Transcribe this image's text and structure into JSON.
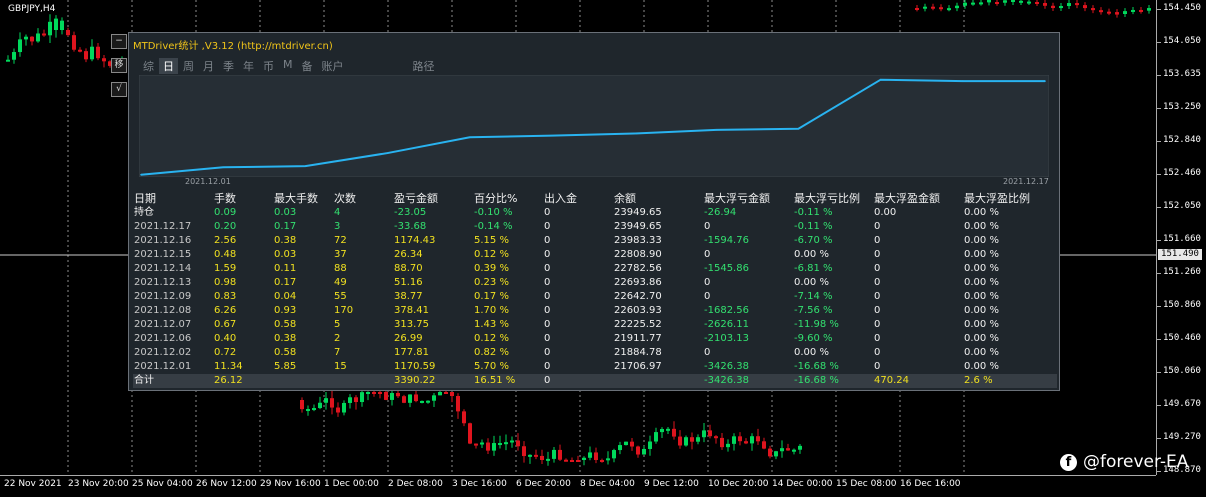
{
  "symbol": "GBPJPY,H4",
  "colors": {
    "bull": "#00d95c",
    "bear": "#e0141e",
    "line": "#29b3f0",
    "yellow": "#f0e020",
    "green": "#33e070",
    "gray": "#c8c8c8",
    "grid": "#ffffff"
  },
  "price_axis": {
    "labels": [
      "154.450",
      "154.050",
      "153.635",
      "153.250",
      "152.840",
      "152.460",
      "152.050",
      "151.660",
      "151.260",
      "150.860",
      "150.460",
      "150.060",
      "149.670",
      "149.270",
      "148.870"
    ],
    "current": "151.490"
  },
  "time_axis": {
    "labels": [
      "22 Nov 2021",
      "23 Nov 20:00",
      "25 Nov 04:00",
      "26 Nov 12:00",
      "29 Nov 16:00",
      "1 Dec 00:00",
      "2 Dec 08:00",
      "3 Dec 16:00",
      "6 Dec 20:00",
      "8 Dec 04:00",
      "9 Dec 12:00",
      "10 Dec 20:00",
      "14 Dec 00:00",
      "15 Dec 08:00",
      "16 Dec 16:00"
    ]
  },
  "side_buttons": [
    "−",
    "移",
    "√"
  ],
  "panel": {
    "title": "MTDriver统计 ,V3.12 (http://mtdriver.cn)",
    "tabs": [
      "综",
      "日",
      "周",
      "月",
      "季",
      "年",
      "币",
      "M",
      "备",
      "账户",
      "路径"
    ],
    "active_tab": 1,
    "start_date": "2021.12.01",
    "end_date": "2021.12.17"
  },
  "chart_data": {
    "type": "line",
    "x": [
      "2021.12.01",
      "2021.12.02",
      "2021.12.06",
      "2021.12.07",
      "2021.12.08",
      "2021.12.09",
      "2021.12.13",
      "2021.12.14",
      "2021.12.15",
      "2021.12.16",
      "2021.12.17",
      "持仓"
    ],
    "values": [
      21706.97,
      21884.78,
      21911.77,
      22225.52,
      22603.93,
      22642.7,
      22693.86,
      22782.56,
      22808.9,
      23983.33,
      23949.65,
      23949.65
    ],
    "ylim": [
      21700,
      24000
    ]
  },
  "table": {
    "headers": [
      "日期",
      "手数",
      "最大手数",
      "次数",
      "盈亏金额",
      "百分比%",
      "出入金",
      "余额",
      "最大浮亏金额",
      "最大浮亏比例",
      "最大浮盈金额",
      "最大浮盈比例"
    ],
    "rows": [
      [
        "持仓",
        "0.09",
        "0.03",
        "4",
        "-23.05",
        "-0.10 %",
        "0",
        "23949.65",
        "-26.94",
        "-0.11 %",
        "0.00",
        "0.00 %"
      ],
      [
        "2021.12.17",
        "0.20",
        "0.17",
        "3",
        "-33.68",
        "-0.14 %",
        "0",
        "23949.65",
        "0",
        "-0.11 %",
        "0",
        "0.00 %"
      ],
      [
        "2021.12.16",
        "2.56",
        "0.38",
        "72",
        "1174.43",
        "5.15 %",
        "0",
        "23983.33",
        "-1594.76",
        "-6.70 %",
        "0",
        "0.00 %"
      ],
      [
        "2021.12.15",
        "0.48",
        "0.03",
        "37",
        "26.34",
        "0.12 %",
        "0",
        "22808.90",
        "0",
        "0.00 %",
        "0",
        "0.00 %"
      ],
      [
        "2021.12.14",
        "1.59",
        "0.11",
        "88",
        "88.70",
        "0.39 %",
        "0",
        "22782.56",
        "-1545.86",
        "-6.81 %",
        "0",
        "0.00 %"
      ],
      [
        "2021.12.13",
        "0.98",
        "0.17",
        "49",
        "51.16",
        "0.23 %",
        "0",
        "22693.86",
        "0",
        "0.00 %",
        "0",
        "0.00 %"
      ],
      [
        "2021.12.09",
        "0.83",
        "0.04",
        "55",
        "38.77",
        "0.17 %",
        "0",
        "22642.70",
        "0",
        "-7.14 %",
        "0",
        "0.00 %"
      ],
      [
        "2021.12.08",
        "6.26",
        "0.93",
        "170",
        "378.41",
        "1.70 %",
        "0",
        "22603.93",
        "-1682.56",
        "-7.56 %",
        "0",
        "0.00 %"
      ],
      [
        "2021.12.07",
        "0.67",
        "0.58",
        "5",
        "313.75",
        "1.43 %",
        "0",
        "22225.52",
        "-2626.11",
        "-11.98 %",
        "0",
        "0.00 %"
      ],
      [
        "2021.12.06",
        "0.40",
        "0.38",
        "2",
        "26.99",
        "0.12 %",
        "0",
        "21911.77",
        "-2103.13",
        "-9.60 %",
        "0",
        "0.00 %"
      ],
      [
        "2021.12.02",
        "0.72",
        "0.58",
        "7",
        "177.81",
        "0.82 %",
        "0",
        "21884.78",
        "0",
        "0.00 %",
        "0",
        "0.00 %"
      ],
      [
        "2021.12.01",
        "11.34",
        "5.85",
        "15",
        "1170.59",
        "5.70 %",
        "0",
        "21706.97",
        "-3426.38",
        "-16.68 %",
        "0",
        "0.00 %"
      ]
    ],
    "total": [
      "合计",
      "26.12",
      "",
      "",
      "3390.22",
      "16.51 %",
      "0",
      "",
      "-3426.38",
      "-16.68 %",
      "470.24",
      "2.6 %"
    ]
  },
  "watermark": {
    "icon": "facebook-icon",
    "icon_glyph": "f",
    "text": "@forever-EA"
  }
}
